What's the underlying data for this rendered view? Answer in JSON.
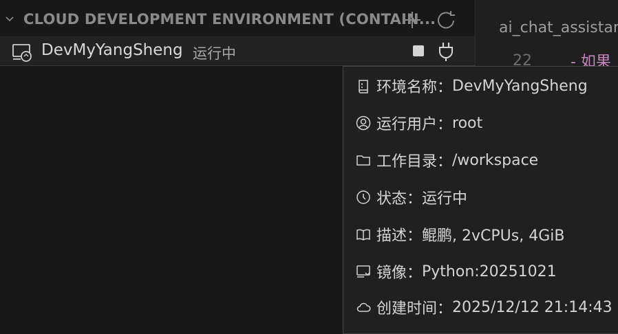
{
  "section": {
    "title": "CLOUD DEVELOPMENT ENVIRONMENT (CONTAIN..."
  },
  "environment": {
    "name": "DevMyYangSheng",
    "status": "运行中"
  },
  "editor": {
    "tab": "ai_chat_assistan",
    "line_number": "22",
    "code": "- 如果"
  },
  "hover": {
    "rows": [
      {
        "label": "环境名称：",
        "value": "DevMyYangSheng",
        "icon": "repo-icon"
      },
      {
        "label": "运行用户：",
        "value": "root",
        "icon": "account-icon"
      },
      {
        "label": "工作目录：",
        "value": "/workspace",
        "icon": "folder-icon"
      },
      {
        "label": "状态：",
        "value": "运行中",
        "icon": "clock-icon"
      },
      {
        "label": "描述：",
        "value": "鲲鹏, 2vCPUs, 4GiB",
        "icon": "book-icon"
      },
      {
        "label": "镜像：",
        "value": "Python:20251021",
        "icon": "image-icon"
      },
      {
        "label": "创建时间：",
        "value": "2025/12/12 21:14:43",
        "icon": "cloud-icon"
      }
    ]
  },
  "colors": {
    "background": "#181818",
    "hover_bg": "#202020",
    "keyword": "#c586c0"
  }
}
